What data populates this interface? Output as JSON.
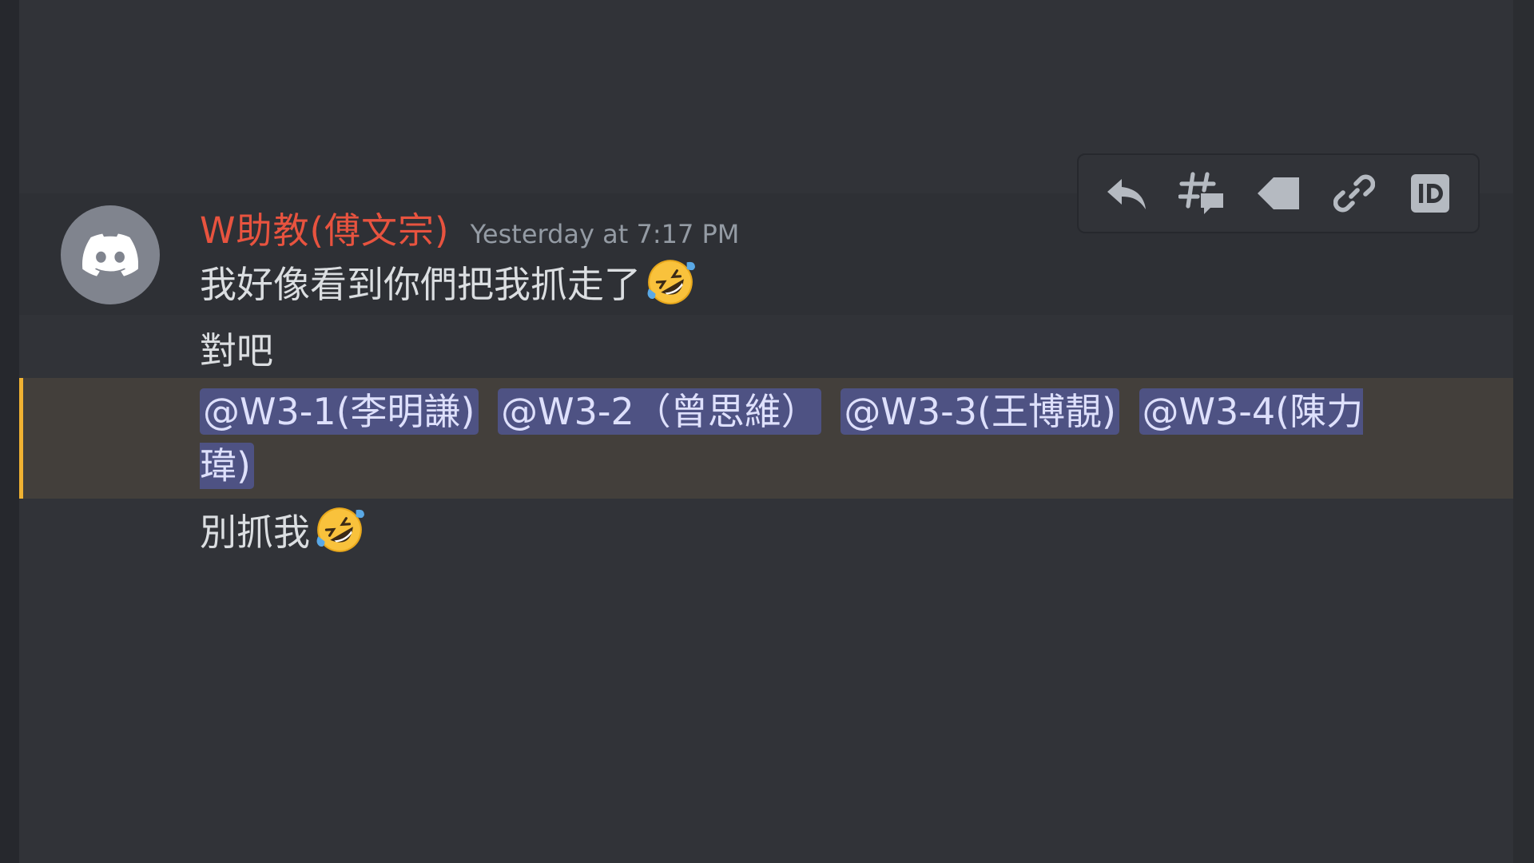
{
  "message": {
    "author": "W助教(傅文宗)",
    "timestamp": "Yesterday at 7:17 PM",
    "lines": [
      "我好像看到你們把我抓走了",
      "對吧",
      "別抓我"
    ],
    "mentions": [
      "@W3-1(李明謙)",
      "@W3-2（曾思維）",
      "@W3-3(王博靚)",
      "@W3-4(陳力瑋)"
    ],
    "emoji": "rolling-on-floor-laughing"
  },
  "toolbar": {
    "icons": [
      "reply-icon",
      "create-thread-icon",
      "tag-icon",
      "copy-link-icon",
      "copy-id-icon"
    ]
  },
  "colors": {
    "background": "#313338",
    "username": "#e8533f",
    "timestamp": "#949ba4",
    "mention_bg": "#4e5283",
    "mention_highlight_row": "#433f3b",
    "mention_bar": "#f0b232",
    "avatar_bg": "#80848e"
  }
}
